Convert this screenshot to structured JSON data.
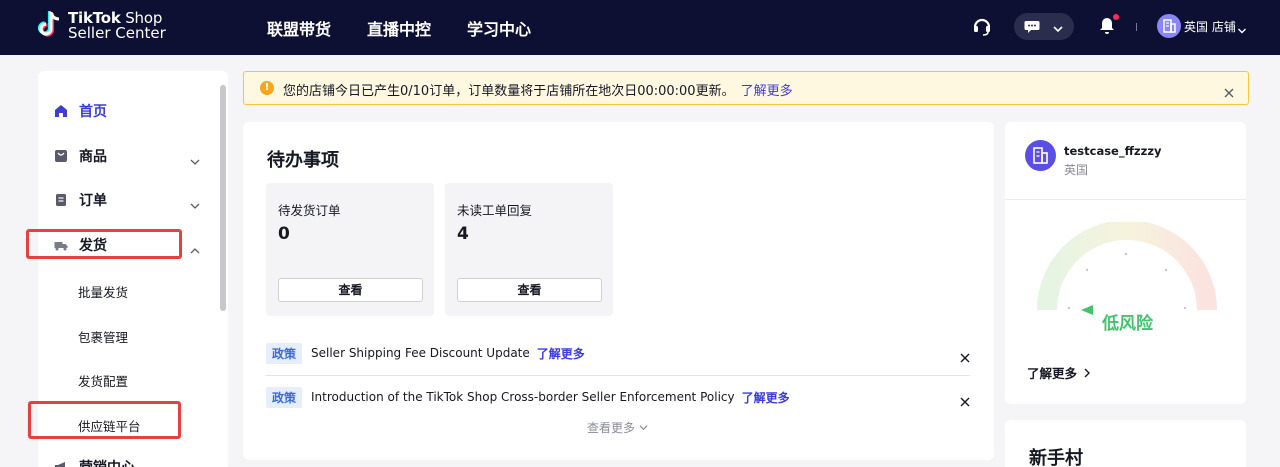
{
  "topbar": {
    "logo": {
      "line1_bold": "TikTok",
      "line1_light": " Shop",
      "line2": "Seller Center"
    },
    "nav": [
      "联盟带货",
      "直播中控",
      "学习中心"
    ],
    "store_name": "英国 店铺",
    "icons": {
      "support": "headset-icon",
      "chat": "chat-bubble-icon",
      "notifications": "bell-icon"
    },
    "colors": {
      "background": "#0d1033",
      "badge": "#fe2c55"
    }
  },
  "sidebar": {
    "items": [
      {
        "label": "首页",
        "icon": "home-icon",
        "active": true
      },
      {
        "label": "商品",
        "icon": "product-icon",
        "expandable": true
      },
      {
        "label": "订单",
        "icon": "order-icon",
        "expandable": true
      },
      {
        "label": "发货",
        "icon": "truck-icon",
        "expanded": true
      },
      {
        "label": "营销中心",
        "icon": "marketing-icon",
        "expandable": true
      }
    ],
    "subitems": [
      "批量发货",
      "包裹管理",
      "发货配置",
      "供应链平台"
    ],
    "accent": "#3c3cd8"
  },
  "notice": {
    "text": "您的店铺今日已产生0/10订单，订单数量将于店铺所在地次日00:00:00更新。",
    "link": "了解更多"
  },
  "todo": {
    "title": "待办事项",
    "boxes": [
      {
        "label": "待发货订单",
        "count": "0",
        "button": "查看"
      },
      {
        "label": "未读工单回复",
        "count": "4",
        "button": "查看"
      }
    ],
    "policies": [
      {
        "tag": "政策",
        "text": "Seller Shipping Fee Discount Update",
        "link": "了解更多"
      },
      {
        "tag": "政策",
        "text": "Introduction of the TikTok Shop Cross-border Seller Enforcement Policy",
        "link": "了解更多"
      }
    ],
    "see_more": "查看更多"
  },
  "account": {
    "name": "testcase_ffzzzy",
    "region": "英国",
    "risk_label": "低风险",
    "learn_more": "了解更多",
    "risk_color": "#45c26e"
  },
  "newbie": {
    "title": "新手村"
  }
}
